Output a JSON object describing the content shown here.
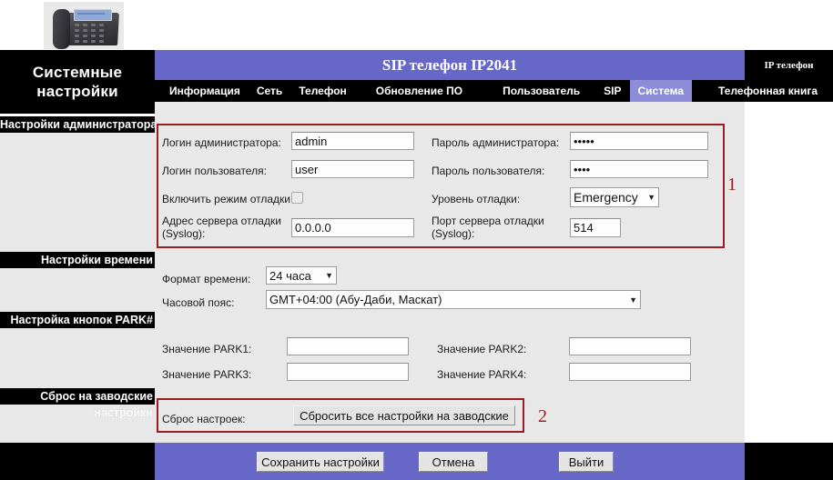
{
  "header": {
    "sidebar_title": "Системные\nнастройки",
    "sidebar_title_line1": "Системные",
    "sidebar_title_line2": "настройки",
    "banner_title": "SIP телефон IP2041",
    "brand_badge": "IP телефон"
  },
  "nav": {
    "items": [
      {
        "label": "Информация",
        "active": false
      },
      {
        "label": "Сеть",
        "active": false
      },
      {
        "label": "Телефон",
        "active": false
      },
      {
        "label": "Обновление ПО",
        "active": false
      },
      {
        "label": "Пользователь",
        "active": false
      },
      {
        "label": "SIP",
        "active": false
      },
      {
        "label": "Система",
        "active": true
      },
      {
        "label": "Телефонная книга",
        "active": false
      }
    ]
  },
  "sections": {
    "admin": {
      "heading": "Настройки администратора"
    },
    "time": {
      "heading": "Настройки времени"
    },
    "park": {
      "heading": "Настройка кнопок PARK#"
    },
    "reset": {
      "heading_line1": "Сброс на заводские",
      "heading_line2": "настройки"
    }
  },
  "admin_form": {
    "admin_login_label": "Логин администратора:",
    "admin_login_value": "admin",
    "admin_password_label": "Пароль администратора:",
    "admin_password_value": "•••••",
    "user_login_label": "Логин пользователя:",
    "user_login_value": "user",
    "user_password_label": "Пароль пользователя:",
    "user_password_value": "••••",
    "debug_enable_label": "Включить режим отладки:",
    "debug_enable_checked": false,
    "debug_level_label": "Уровень отладки:",
    "debug_level_value": "Emergency",
    "syslog_addr_label_line1": "Адрес сервера отладки",
    "syslog_addr_label_line2": "(Syslog):",
    "syslog_addr_value": "0.0.0.0",
    "syslog_port_label_line1": "Порт сервера отладки",
    "syslog_port_label_line2": "(Syslog):",
    "syslog_port_value": "514"
  },
  "time_form": {
    "time_format_label": "Формат времени:",
    "time_format_value": "24 часа",
    "timezone_label": "Часовой пояс:",
    "timezone_value": "GMT+04:00 (Абу-Даби, Маскат)"
  },
  "park_form": {
    "park1_label": "Значение PARK1:",
    "park1_value": "",
    "park2_label": "Значение PARK2:",
    "park2_value": "",
    "park3_label": "Значение PARK3:",
    "park3_value": "",
    "park4_label": "Значение PARK4:",
    "park4_value": ""
  },
  "reset_form": {
    "reset_label": "Сброс настроек:",
    "reset_button": "Сбросить все настройки на заводские"
  },
  "footer": {
    "save_label": "Сохранить настройки",
    "cancel_label": "Отмена",
    "exit_label": "Выйти"
  },
  "annotations": {
    "one": "1",
    "two": "2",
    "highlight_color": "#991d20"
  },
  "colors": {
    "banner_purple": "#6667c7",
    "active_tab": "#8c8cd8",
    "panel_gray": "#e8e8e8",
    "black": "#000000"
  }
}
